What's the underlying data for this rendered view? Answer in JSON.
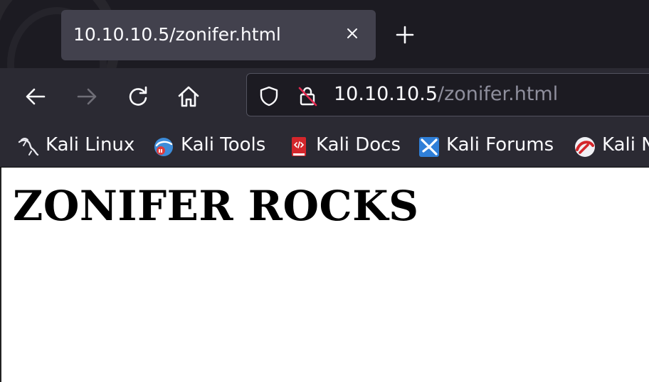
{
  "tab": {
    "title": "10.10.10.5/zonifer.html"
  },
  "url_bar": {
    "host": "10.10.10.5",
    "path": "/zonifer.html"
  },
  "bookmarks": [
    {
      "label": "Kali Linux",
      "icon": "kali-dragon-icon"
    },
    {
      "label": "Kali Tools",
      "icon": "kali-tools-icon"
    },
    {
      "label": "Kali Docs",
      "icon": "kali-docs-icon"
    },
    {
      "label": "Kali Forums",
      "icon": "kali-forums-icon"
    },
    {
      "label": "Kali N",
      "icon": "kali-nethunter-icon"
    }
  ],
  "page": {
    "heading": "ZONIFER ROCKS"
  },
  "colors": {
    "tab_strip": "#1c1b22",
    "toolbar": "#2b2a33",
    "active_tab": "#42414d",
    "url_path": "#8f8f9d"
  }
}
